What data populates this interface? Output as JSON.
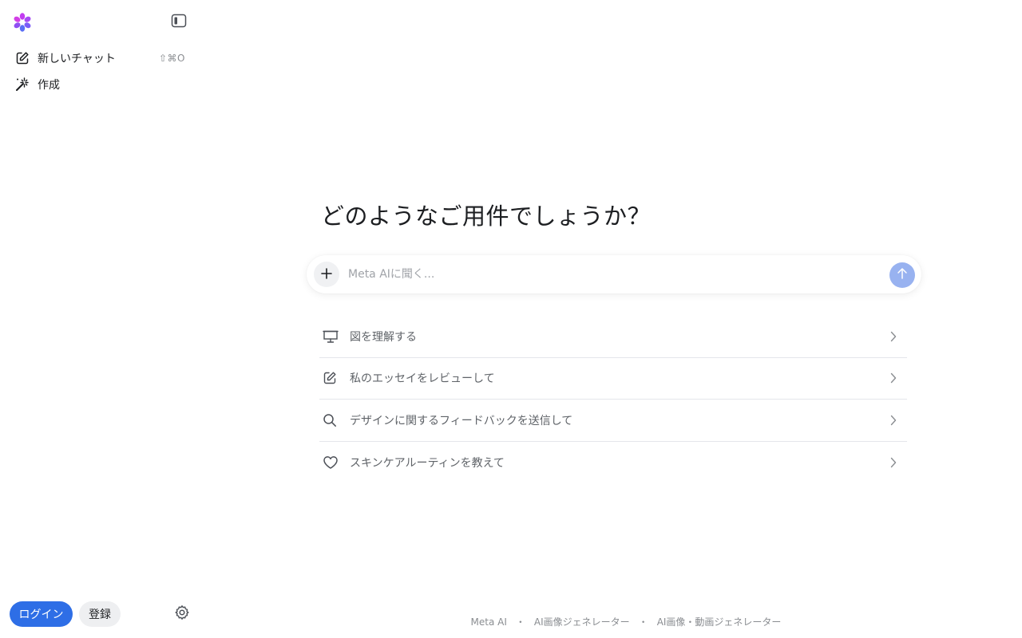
{
  "sidebar": {
    "logo_icon": "meta-ai-flower-logo",
    "collapse_icon": "sidebar-toggle-icon",
    "new_chat": {
      "label": "新しいチャット",
      "shortcut": "⇧⌘O",
      "icon": "edit-square-icon"
    },
    "create": {
      "label": "作成",
      "icon": "magic-wand-icon"
    },
    "login_label": "ログイン",
    "signup_label": "登録",
    "settings_icon": "gear-icon"
  },
  "main": {
    "heading": "どのようなご用件でしょうか？",
    "composer": {
      "placeholder": "Meta AIに聞く...",
      "value": "",
      "plus_icon": "plus-icon",
      "send_icon": "arrow-up-icon"
    },
    "suggestions": [
      {
        "label": "図を理解する",
        "icon": "presentation-board-icon"
      },
      {
        "label": "私のエッセイをレビューして",
        "icon": "edit-square-icon"
      },
      {
        "label": "デザインに関するフィードバックを送信して",
        "icon": "search-icon"
      },
      {
        "label": "スキンケアルーティンを教えて",
        "icon": "heart-icon"
      }
    ]
  },
  "footer": {
    "links": [
      "Meta AI",
      "AI画像ジェネレーター",
      "AI画像・動画ジェネレーター"
    ],
    "separator": "・"
  },
  "colors": {
    "accent": "#2e6ee6",
    "send_disabled": "#98b2f0",
    "muted_text": "#8a8d91",
    "divider": "#e4e6eb"
  }
}
